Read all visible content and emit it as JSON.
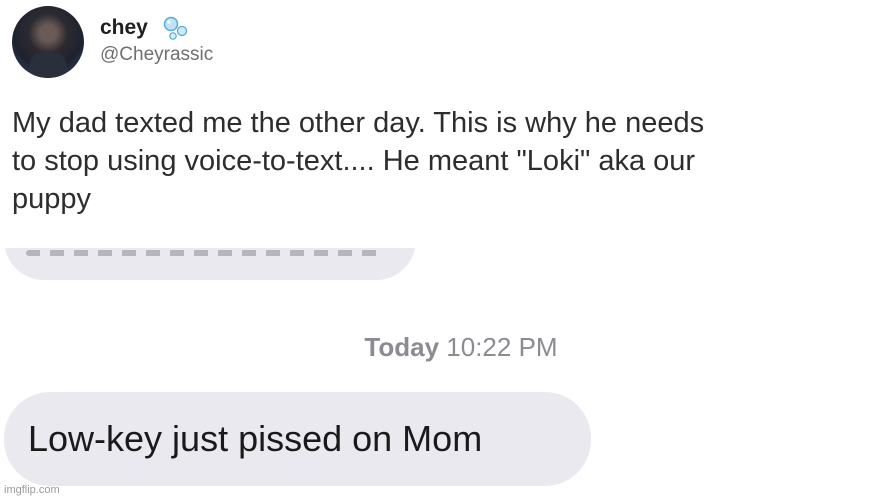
{
  "tweet": {
    "display_name": "chey",
    "handle": "@Cheyrassic",
    "badge_icon": "bubbles-icon",
    "text_lines": [
      "My dad texted me the other day. This is why he needs",
      "to stop using voice-to-text.... He meant \"Loki\" aka our",
      "puppy"
    ]
  },
  "messages": {
    "timestamp_day": "Today",
    "timestamp_time": "10:22 PM",
    "received_text": "Low-key just pissed on Mom"
  },
  "watermark": "imgflip.com",
  "colors": {
    "bubble": "#e9e9ef",
    "timestamp": "#8b8b93",
    "handle": "#6f6f6f"
  }
}
